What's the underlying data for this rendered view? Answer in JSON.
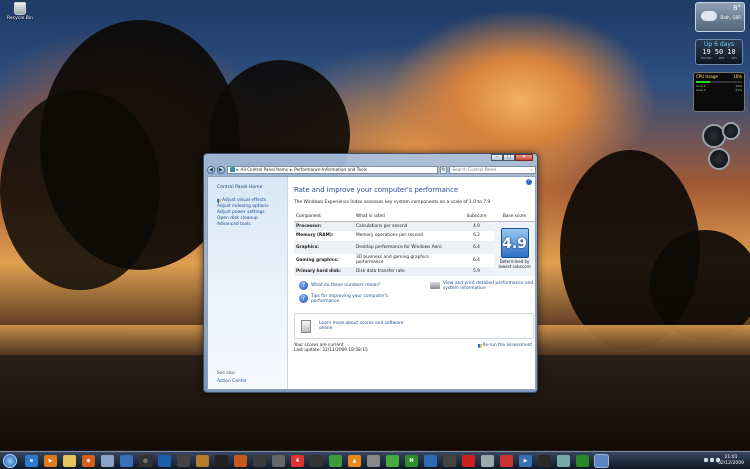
{
  "desktop": {
    "recycle_label": "Recycle Bin"
  },
  "gadgets": {
    "weather": {
      "temp": "8°",
      "location": "Bath, GBR"
    },
    "uptime": {
      "label": "Up 6 days",
      "digits": [
        "19",
        "50",
        "10"
      ],
      "units": [
        "HOURS",
        "MIN",
        "SEC"
      ]
    },
    "cpu": {
      "title": "CPU Usage",
      "value": "16%",
      "core1": "Core 1",
      "core1_val": "12%",
      "core2": "Core 2",
      "core2_val": "21%"
    }
  },
  "window": {
    "breadcrumb_root": "All Control Panel Items",
    "breadcrumb_leaf": "Performance Information and Tools",
    "search_placeholder": "Search Control Panel",
    "nav": {
      "home": "Control Panel Home",
      "items": [
        "Adjust visual effects",
        "Adjust indexing options",
        "Adjust power settings",
        "Open disk cleanup",
        "Advanced tools"
      ],
      "see_also": "See also",
      "action_center": "Action Center"
    },
    "heading": "Rate and improve your computer's performance",
    "intro": "The Windows Experience Index assesses key system components on a scale of 1.0 to 7.9.",
    "table": {
      "headers": [
        "Component",
        "What is rated",
        "Subscore",
        "Base score"
      ],
      "rows": [
        {
          "component": "Processor:",
          "rated": "Calculations per second",
          "subscore": "4.9"
        },
        {
          "component": "Memory (RAM):",
          "rated": "Memory operations per second",
          "subscore": "6.2"
        },
        {
          "component": "Graphics:",
          "rated": "Desktop performance for Windows Aero",
          "subscore": "6.4"
        },
        {
          "component": "Gaming graphics:",
          "rated": "3D business and gaming graphics performance",
          "subscore": "6.4"
        },
        {
          "component": "Primary hard disk:",
          "rated": "Disk data transfer rate",
          "subscore": "5.9"
        }
      ],
      "base_score": "4.9",
      "base_caption": "Determined by lowest subscore"
    },
    "links": {
      "numbers": "What do these numbers mean?",
      "tips": "Tips for improving your computer's performance.",
      "print": "View and print detailed performance and system information",
      "learn": "Learn more about scores and software online"
    },
    "status": {
      "current": "Your scores are current",
      "last_update": "Last update: 22/11/2009 18:58:15",
      "rerun": "Re-run the assessment"
    }
  },
  "taskbar": {
    "time": "21:01",
    "date": "02/12/2009"
  }
}
